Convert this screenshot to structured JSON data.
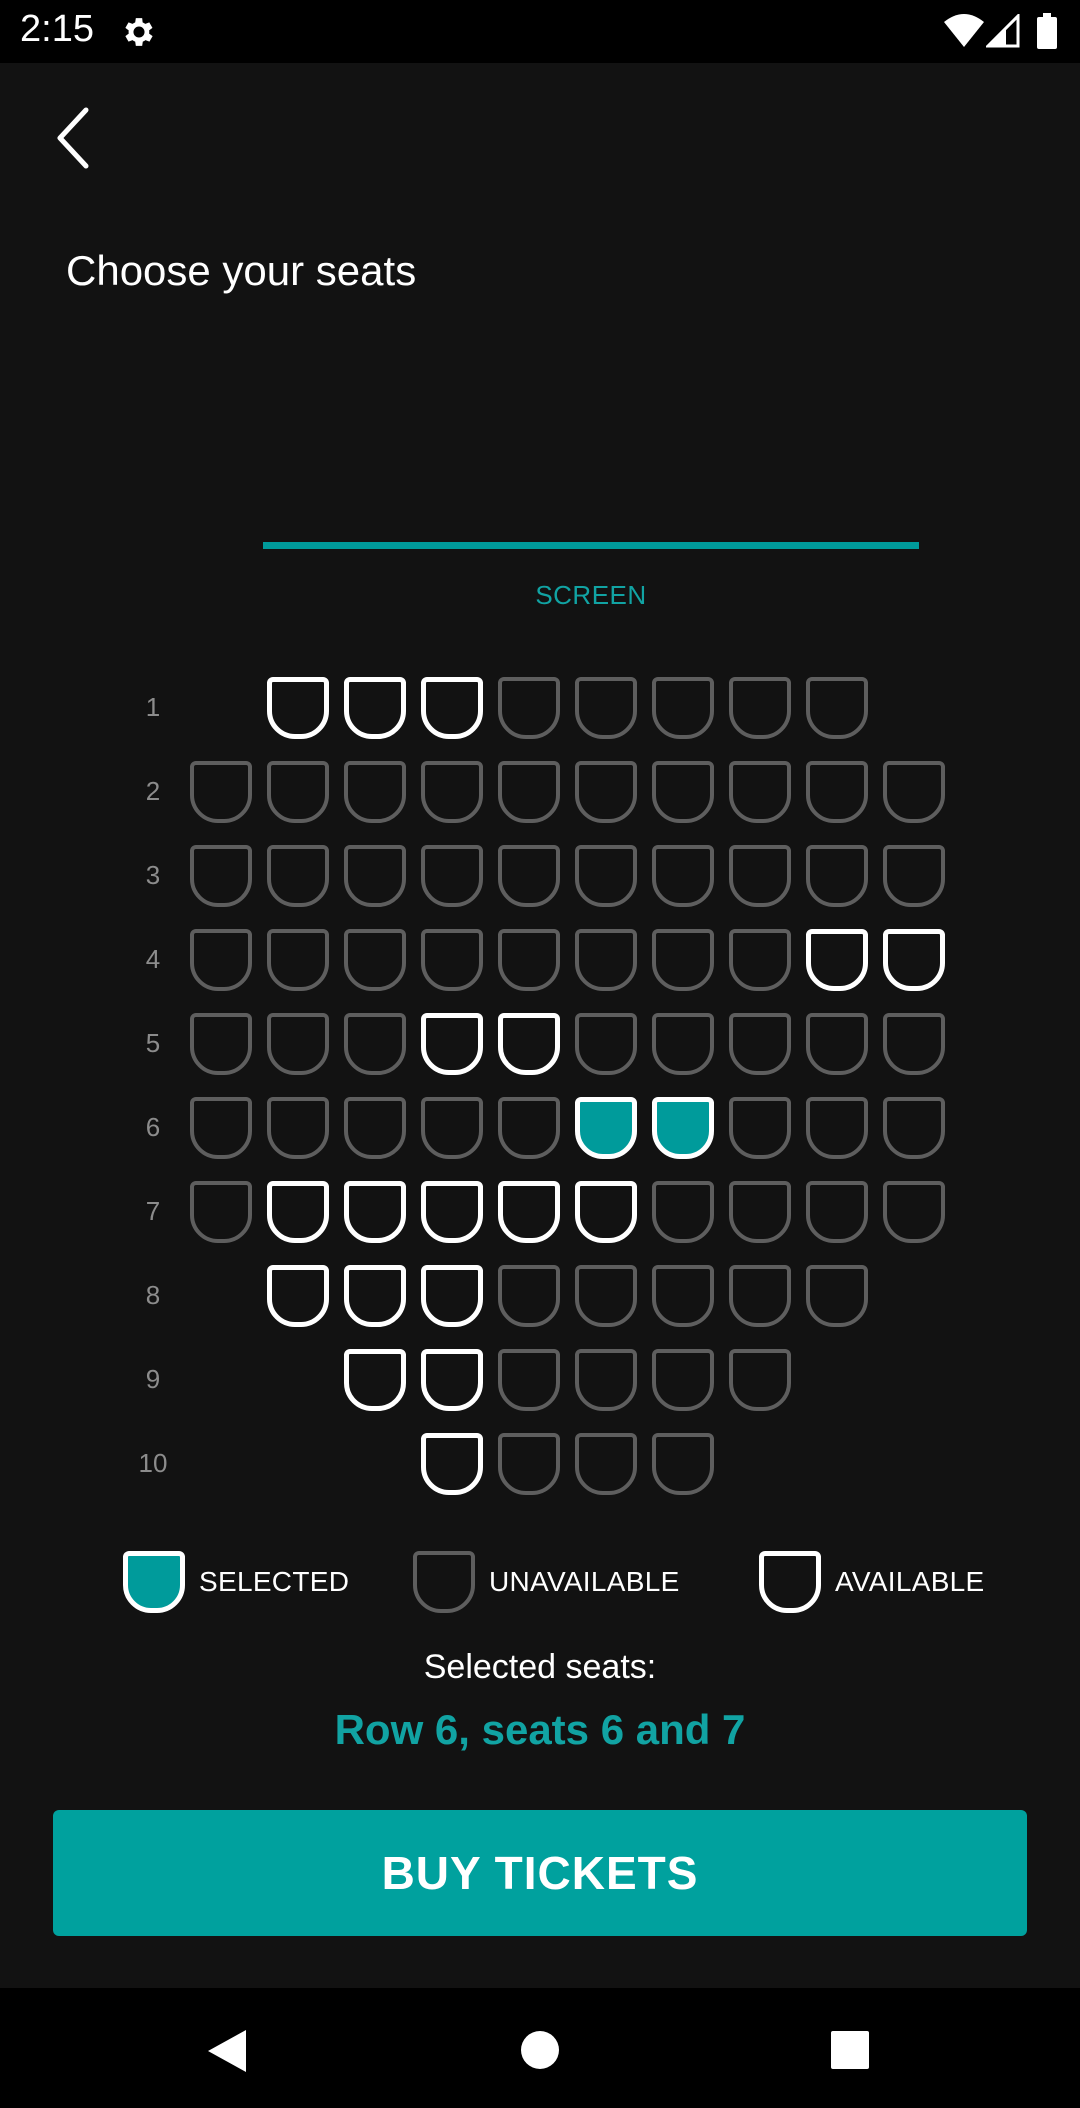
{
  "status_bar": {
    "time": "2:15",
    "icons": [
      "gear-icon",
      "wifi-icon",
      "signal-icon",
      "battery-icon"
    ]
  },
  "header": {
    "back_icon": "chevron-left-icon",
    "title": "Choose your seats"
  },
  "screen": {
    "label": "SCREEN"
  },
  "seat_map": {
    "rows": [
      {
        "label": "1",
        "seats": [
          "available",
          "available",
          "available",
          "unavailable",
          "unavailable",
          "unavailable",
          "unavailable",
          "unavailable"
        ]
      },
      {
        "label": "2",
        "seats": [
          "unavailable",
          "unavailable",
          "unavailable",
          "unavailable",
          "unavailable",
          "unavailable",
          "unavailable",
          "unavailable",
          "unavailable",
          "unavailable"
        ]
      },
      {
        "label": "3",
        "seats": [
          "unavailable",
          "unavailable",
          "unavailable",
          "unavailable",
          "unavailable",
          "unavailable",
          "unavailable",
          "unavailable",
          "unavailable",
          "unavailable"
        ]
      },
      {
        "label": "4",
        "seats": [
          "unavailable",
          "unavailable",
          "unavailable",
          "unavailable",
          "unavailable",
          "unavailable",
          "unavailable",
          "unavailable",
          "available",
          "available"
        ]
      },
      {
        "label": "5",
        "seats": [
          "unavailable",
          "unavailable",
          "unavailable",
          "available",
          "available",
          "unavailable",
          "unavailable",
          "unavailable",
          "unavailable",
          "unavailable"
        ]
      },
      {
        "label": "6",
        "seats": [
          "unavailable",
          "unavailable",
          "unavailable",
          "unavailable",
          "unavailable",
          "selected",
          "selected",
          "unavailable",
          "unavailable",
          "unavailable"
        ]
      },
      {
        "label": "7",
        "seats": [
          "unavailable",
          "available",
          "available",
          "available",
          "available",
          "available",
          "unavailable",
          "unavailable",
          "unavailable",
          "unavailable"
        ]
      },
      {
        "label": "8",
        "seats": [
          "available",
          "available",
          "available",
          "unavailable",
          "unavailable",
          "unavailable",
          "unavailable",
          "unavailable"
        ]
      },
      {
        "label": "9",
        "seats": [
          "available",
          "available",
          "unavailable",
          "unavailable",
          "unavailable",
          "unavailable"
        ]
      },
      {
        "label": "10",
        "seats": [
          "available",
          "unavailable",
          "unavailable",
          "unavailable"
        ]
      }
    ]
  },
  "legend": {
    "selected": "SELECTED",
    "unavailable": "UNAVAILABLE",
    "available": "AVAILABLE"
  },
  "selection": {
    "caption": "Selected seats:",
    "value": "Row 6, seats 6 and 7"
  },
  "actions": {
    "buy_label": "BUY TICKETS"
  },
  "colors": {
    "accent": "#009b9b",
    "background": "#121212",
    "unavailable": "#5e5e5e",
    "available": "#ffffff"
  },
  "nav_bar": {
    "icons": [
      "nav-back-icon",
      "nav-home-icon",
      "nav-recents-icon"
    ]
  }
}
